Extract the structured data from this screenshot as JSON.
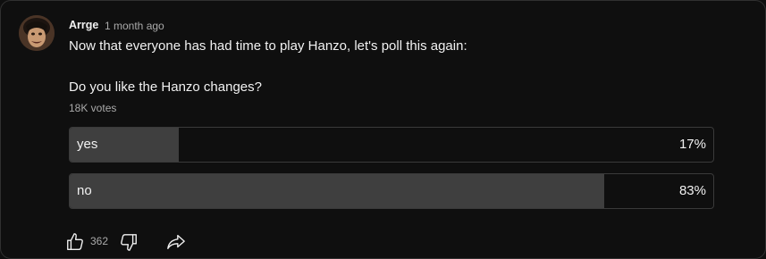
{
  "comment": {
    "author": "Arrge",
    "timestamp": "1 month ago",
    "text_line1": "Now that everyone has had time to play Hanzo, let's poll this again:",
    "question": "Do you like the Hanzo changes?",
    "votes": "18K votes"
  },
  "poll": {
    "options": [
      {
        "label": "yes",
        "percent_text": "17%",
        "fraction": 0.17
      },
      {
        "label": "no",
        "percent_text": "83%",
        "fraction": 0.83
      }
    ]
  },
  "actions": {
    "like_count": "362",
    "like_icon": "thumb-up-icon",
    "dislike_icon": "thumb-down-icon",
    "share_icon": "share-icon"
  },
  "colors": {
    "background": "#0f0f0f",
    "bar_fill": "#3f3f3f",
    "text": "#f1f1f1",
    "secondary_text": "#aaaaaa"
  }
}
